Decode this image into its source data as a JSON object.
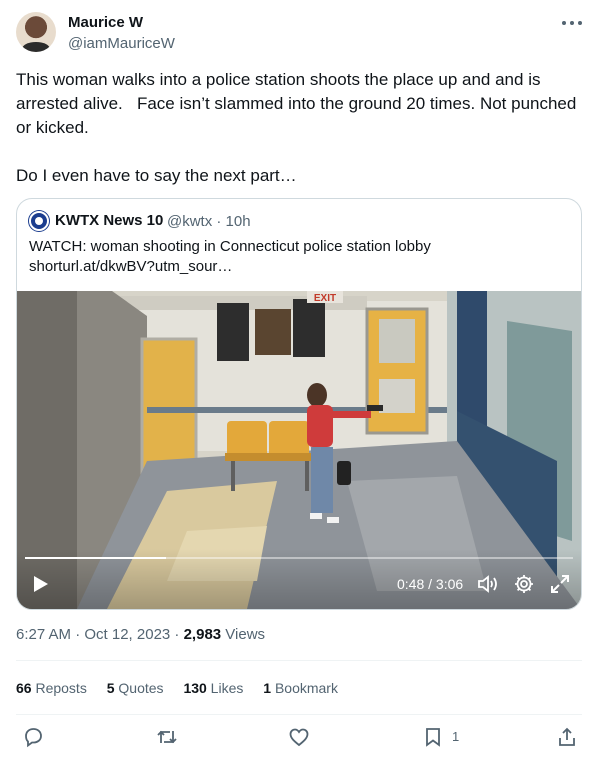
{
  "author": {
    "name": "Maurice W",
    "handle": "@iamMauriceW"
  },
  "tweet": {
    "paragraphs": [
      "This woman walks into a police station shoots the place up and and is arrested alive.   Face isn’t slammed into the ground 20 times. Not punched or kicked.",
      "Do I even have to say the next part…"
    ]
  },
  "quote": {
    "name": "KWTX News 10",
    "meta": "@kwtx · 10h",
    "line1": "WATCH:  woman shooting in Connecticut police station lobby",
    "line2": "shorturl.at/dkwBV?utm_sour…",
    "video": {
      "current": "0:48",
      "duration": "3:06",
      "time_label": "0:48 / 3:06",
      "progress": 0.258,
      "exit_sign": "EXIT"
    }
  },
  "meta": {
    "time": "6:27 AM · Oct 12, 2023 · ",
    "views_count": "2,983",
    "views_label": " Views"
  },
  "stats": {
    "reposts_count": "66",
    "reposts_label": " Reposts",
    "quotes_count": "5",
    "quotes_label": " Quotes",
    "likes_count": "130",
    "likes_label": " Likes",
    "bookmarks_count": "1",
    "bookmarks_label": " Bookmark"
  },
  "actions": {
    "bookmark_count": "1"
  },
  "icons": [
    "more-icon",
    "play-icon",
    "volume-icon",
    "settings-icon",
    "fullscreen-icon",
    "reply-icon",
    "repost-icon",
    "like-icon",
    "bookmark-icon",
    "share-icon"
  ],
  "colors": {
    "text": "#0f1419",
    "muted": "#536471",
    "border": "#cfd9de",
    "divider": "#eff3f4"
  }
}
